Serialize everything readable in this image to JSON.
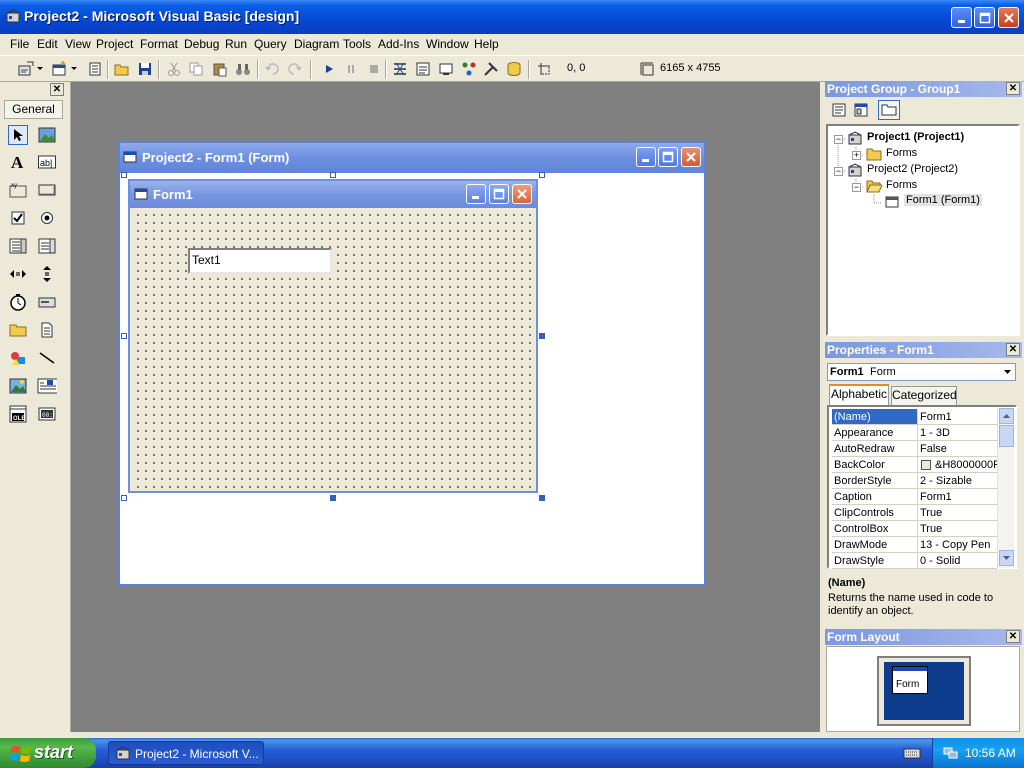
{
  "window": {
    "title": "Project2 - Microsoft Visual Basic [design]"
  },
  "menu": [
    "File",
    "Edit",
    "View",
    "Project",
    "Format",
    "Debug",
    "Run",
    "Query",
    "Diagram",
    "Tools",
    "Add-Ins",
    "Window",
    "Help"
  ],
  "toolbar": {
    "position": "0, 0",
    "size": "6165 x 4755"
  },
  "toolbox": {
    "tab_label": "General"
  },
  "designer": {
    "outer_title": "Project2 - Form1 (Form)",
    "form_title": "Form1",
    "textbox_text": "Text1"
  },
  "project_group": {
    "title": "Project Group - Group1",
    "tree": {
      "project1": "Project1 (Project1)",
      "project1_forms": "Forms",
      "project2": "Project2 (Project2)",
      "project2_forms": "Forms",
      "form1": "Form1 (Form1)"
    }
  },
  "properties": {
    "title": "Properties - Form1",
    "object_name": "Form1",
    "object_type": "Form",
    "tabs": {
      "alphabetic": "Alphabetic",
      "categorized": "Categorized"
    },
    "rows": [
      {
        "name": "(Name)",
        "value": "Form1"
      },
      {
        "name": "Appearance",
        "value": "1 - 3D"
      },
      {
        "name": "AutoRedraw",
        "value": "False"
      },
      {
        "name": "BackColor",
        "value": "&H8000000F"
      },
      {
        "name": "BorderStyle",
        "value": "2 - Sizable"
      },
      {
        "name": "Caption",
        "value": "Form1"
      },
      {
        "name": "ClipControls",
        "value": "True"
      },
      {
        "name": "ControlBox",
        "value": "True"
      },
      {
        "name": "DrawMode",
        "value": "13 - Copy Pen"
      },
      {
        "name": "DrawStyle",
        "value": "0 - Solid"
      }
    ],
    "description_title": "(Name)",
    "description_text": "Returns the name used in code to identify an object."
  },
  "form_layout": {
    "title": "Form Layout",
    "form_label": "Form"
  },
  "taskbar": {
    "start_label": "start",
    "task_label": "Project2 - Microsoft V...",
    "clock": "10:56 AM"
  },
  "colors": {
    "titlebar": "#0548d4",
    "selection": "#316ac5",
    "workspace": "#808080",
    "panel_title": "#7b97e0"
  }
}
